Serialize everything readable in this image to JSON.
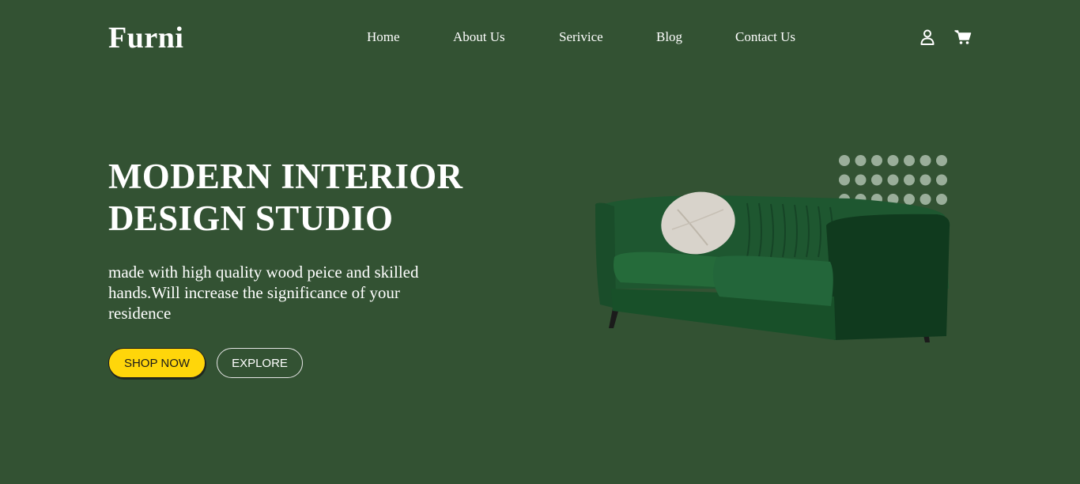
{
  "header": {
    "logo": "Furni",
    "nav": [
      {
        "label": "Home"
      },
      {
        "label": "About Us"
      },
      {
        "label": "Serivice"
      },
      {
        "label": "Blog"
      },
      {
        "label": "Contact Us"
      }
    ],
    "icons": {
      "user": "user-icon",
      "cart": "cart-icon"
    }
  },
  "hero": {
    "title_line1": "MODERN INTERIOR",
    "title_line2": "DESIGN STUDIO",
    "description": "made with high quality wood peice and skilled hands.Will increase the significance of your residence",
    "buttons": {
      "shop": "SHOP NOW",
      "explore": "EXPLORE"
    },
    "image": "green-velvet-sofa"
  },
  "colors": {
    "background": "#335233",
    "accent": "#ffd60a",
    "sofa": "#1f5c32",
    "dots": "#9aae9a"
  }
}
